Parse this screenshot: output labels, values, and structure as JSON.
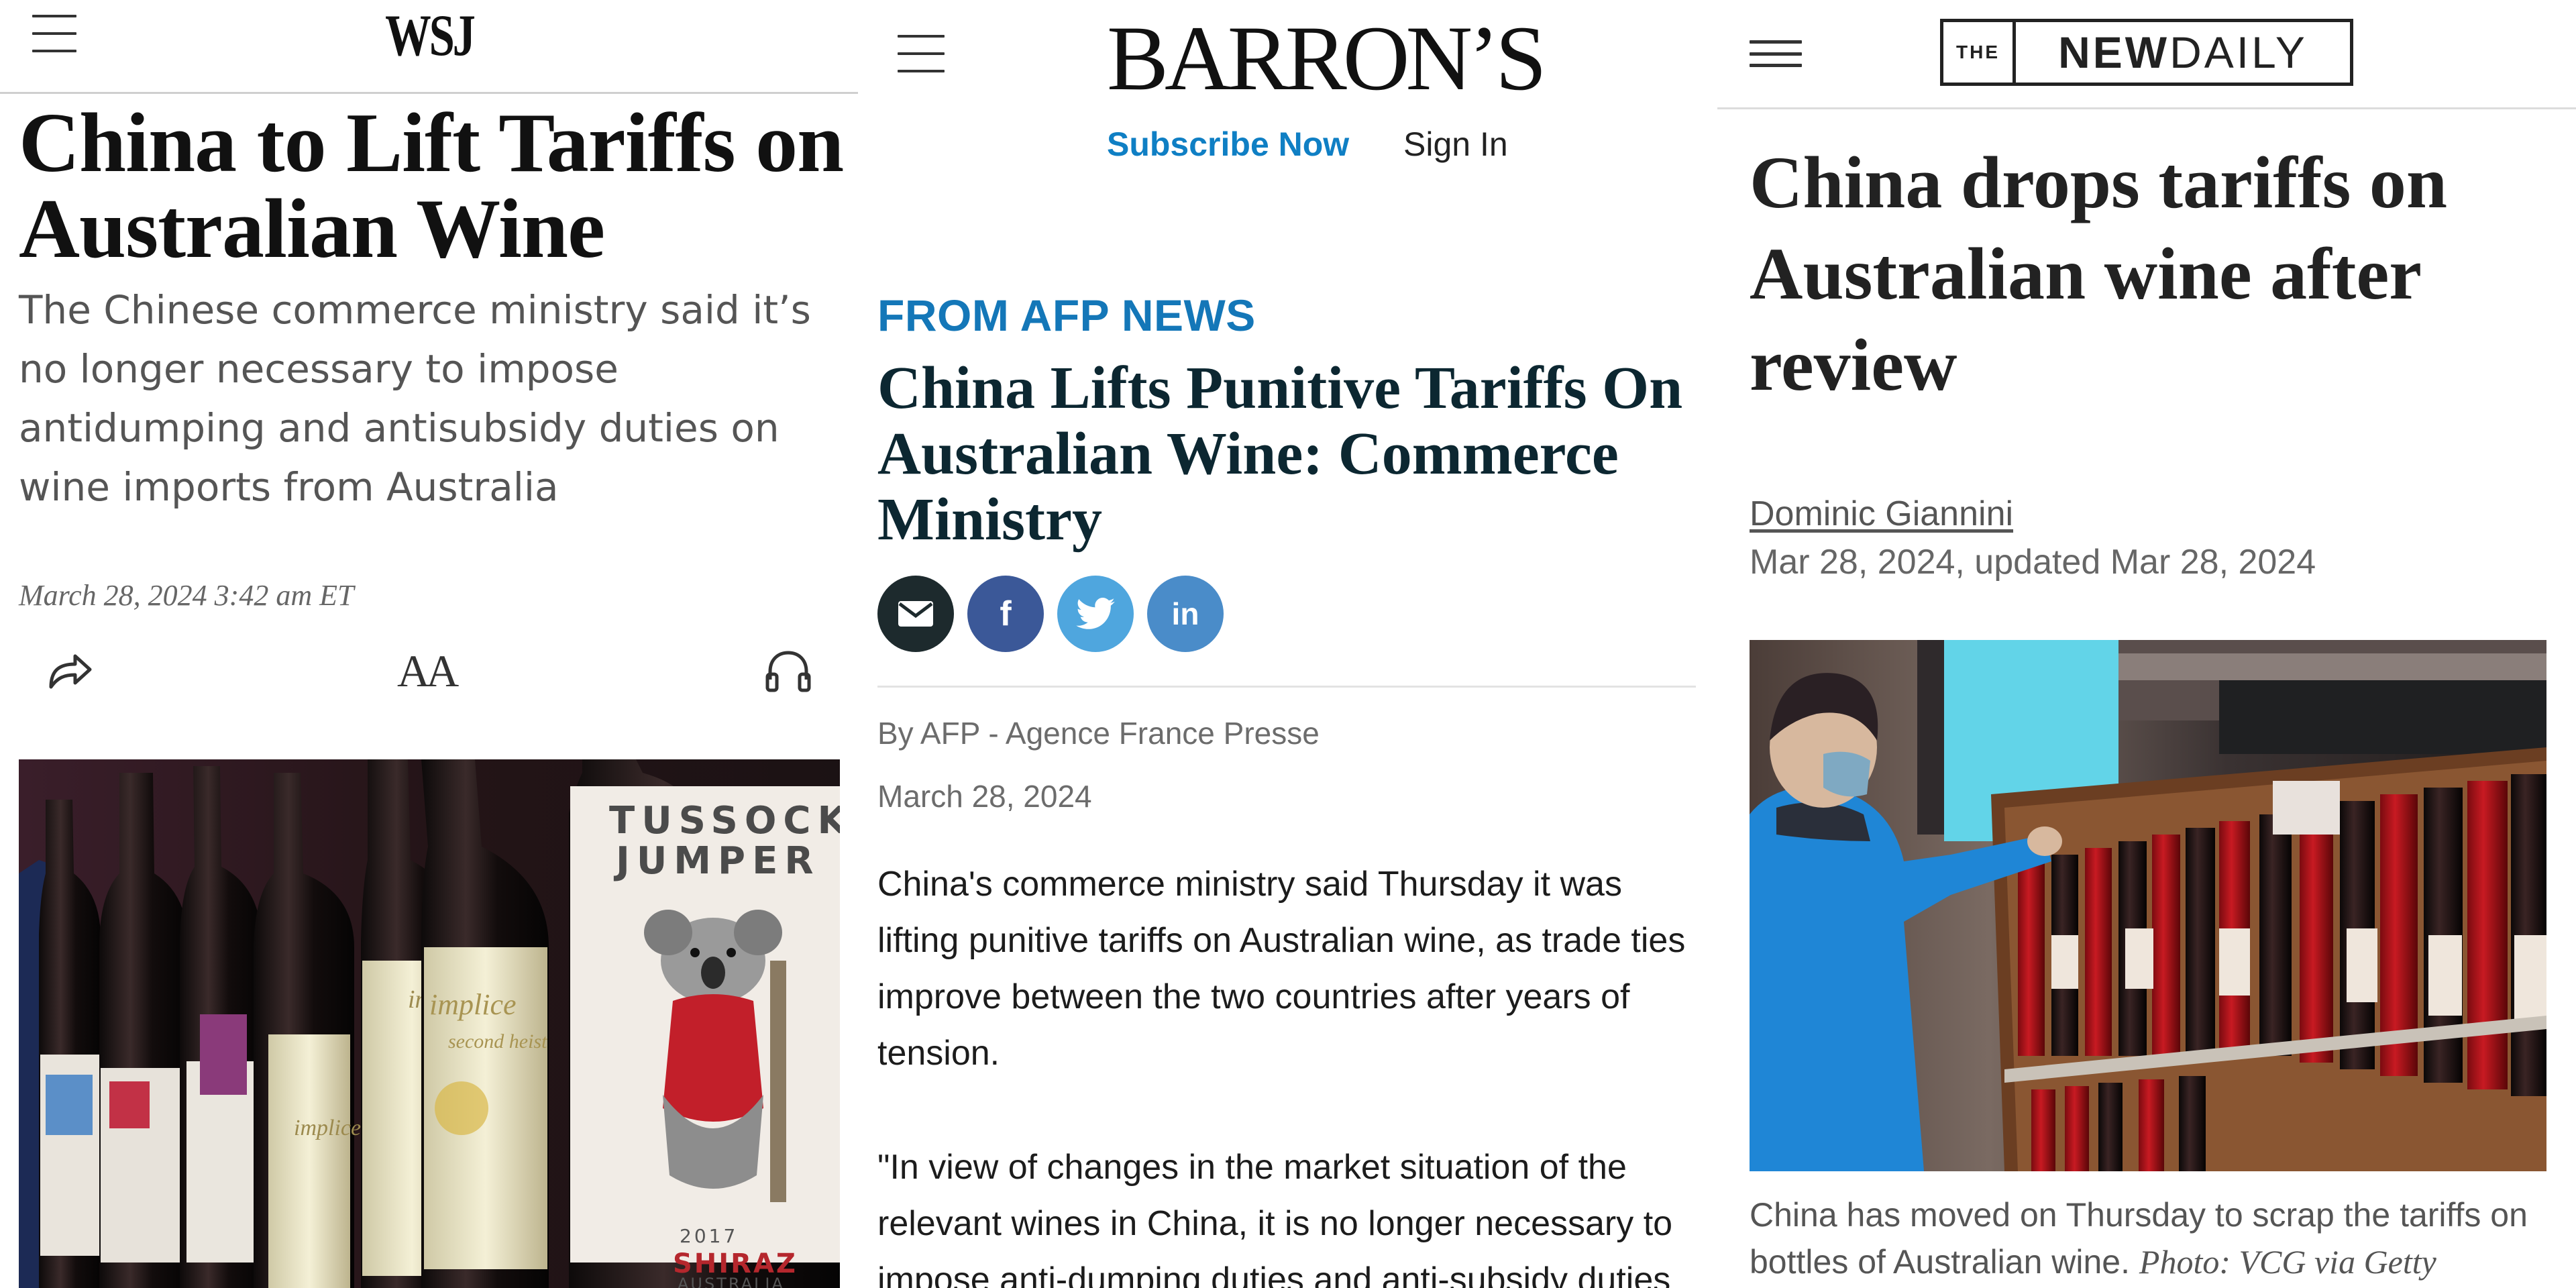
{
  "wsj": {
    "logo": "WSJ",
    "headline": "China to Lift Tariffs on Australian Wine",
    "dek": "The Chinese commerce ministry said it’s no longer necessary to impose antidumping and antisubsidy duties on wine imports from Australia",
    "date": "March 28, 2024 3:42 am ET",
    "text_size_label": "AA",
    "photo_labels": {
      "brand_line1": "TUSSOCK",
      "brand_line2": "JUMPER",
      "year": "2017",
      "variety": "SHIRAZ",
      "country": "AUSTRALIA",
      "other_brand": "implice",
      "other_sub": "second heist"
    }
  },
  "barrons": {
    "logo": "BARRON’S",
    "subscribe": "Subscribe Now",
    "sign_in": "Sign In",
    "kicker": "FROM AFP NEWS",
    "headline": "China Lifts Punitive Tariffs On Australian Wine: Commerce Ministry",
    "share": {
      "email": "✉",
      "facebook": "f",
      "twitter": "t",
      "linkedin": "in"
    },
    "byline": "By AFP - Agence France Presse",
    "date": "March 28, 2024",
    "para1": "China's commerce ministry said Thursday it was lifting punitive tariffs on Australian wine, as trade ties improve between the two countries after years of tension.",
    "para2": "\"In view of changes in the market situation of the relevant wines in China, it is no longer necessary to impose anti-dumping duties and anti-subsidy duties"
  },
  "newdaily": {
    "logo_the": "THE",
    "logo_new": "NEW",
    "logo_daily": "DAILY",
    "headline": "China drops tariffs on Australian wine after review",
    "author": "Dominic Giannini",
    "date": "Mar 28, 2024, updated Mar 28, 2024",
    "caption": "China has moved on Thursday to scrap the tariffs on bottles of Australian wine.",
    "photo_credit": "Photo: VCG via Getty"
  },
  "colors": {
    "barrons_blue": "#0f7fc4",
    "email": "#1d2a2d",
    "facebook": "#3b5898",
    "twitter": "#4fa6de",
    "linkedin": "#4a8cc9"
  }
}
